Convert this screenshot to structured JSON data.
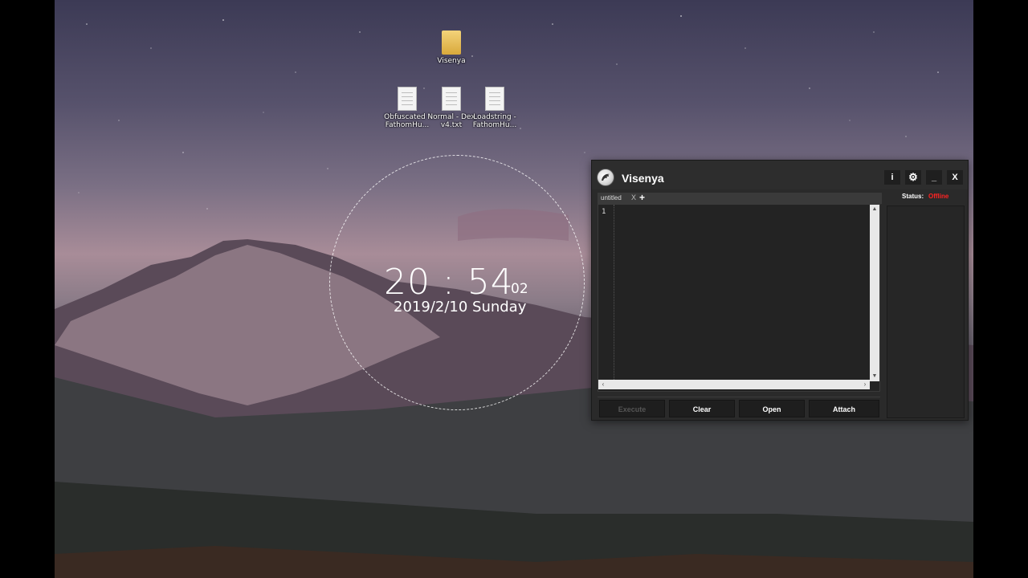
{
  "desktop": {
    "icons": [
      {
        "label": "Visenya",
        "icon": "folder-icon"
      },
      {
        "label": "Obfuscated -FathomHu...",
        "icon": "text-file-icon"
      },
      {
        "label": "Normal - Dex v4.txt",
        "icon": "text-file-icon"
      },
      {
        "label": "Loadstring - FathomHu...",
        "icon": "text-file-icon"
      }
    ],
    "clock": {
      "time": "20 : 54",
      "seconds": "02",
      "date": "2019/2/10 Sunday"
    }
  },
  "app": {
    "title": "Visenya",
    "title_buttons": {
      "info": "i",
      "settings": "⚙",
      "minimize": "_",
      "close": "X"
    },
    "tab": {
      "label": "untitled",
      "close": "X",
      "add": "+"
    },
    "editor": {
      "line_number": "1"
    },
    "buttons": {
      "execute": "Execute",
      "clear": "Clear",
      "open": "Open",
      "attach": "Attach"
    },
    "status": {
      "label": "Status:",
      "value": "Offline",
      "value_color": "#ff2222"
    }
  }
}
